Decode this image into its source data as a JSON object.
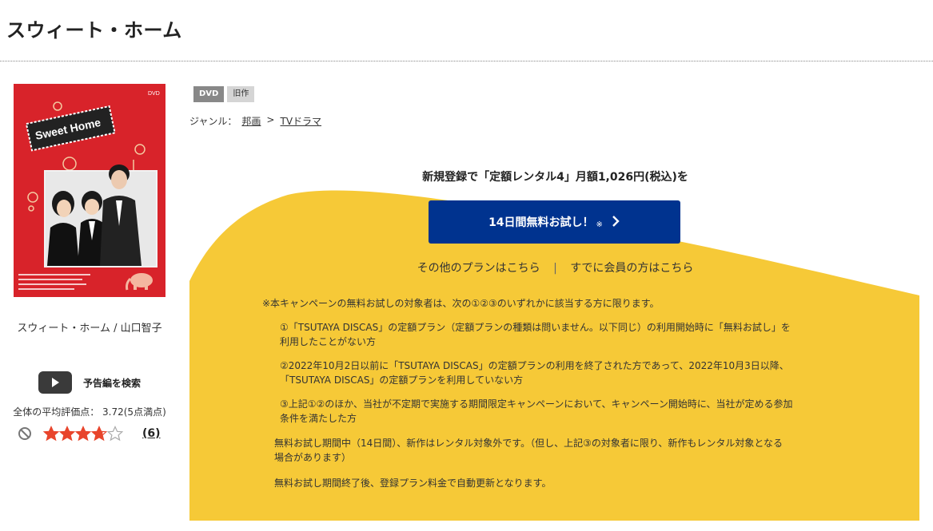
{
  "title": "スウィート・ホーム",
  "poster": {
    "logo_text": "Sweet Home",
    "dvd_mark": "DVD"
  },
  "cast_label": "スウィート・ホーム / 山口智子",
  "trailer": {
    "label": "予告編を検索",
    "icon": "play-icon"
  },
  "rating": {
    "text": "全体の平均評価点： 3.72(5点満点)",
    "value": 3.72,
    "max": 5,
    "review_count": "(6)",
    "star_color": "#e8452c"
  },
  "badges": {
    "dvd": "DVD",
    "old": "旧作"
  },
  "genre": {
    "label": "ジャンル：",
    "path": [
      "邦画",
      "TVドラマ"
    ],
    "separator": ">"
  },
  "promo": {
    "heading": "新規登録で「定額レンタル4」月額1,026円(税込)を",
    "button_label": "14日間無料お試し！",
    "button_note": "※",
    "other_plans": "その他のプランはこちら",
    "divider": "|",
    "members": "すでに会員の方はこちら",
    "bg_color": "#f6c937",
    "button_color": "#00338f"
  },
  "notes": {
    "heading": "※本キャンペーンの無料お試しの対象者は、次の①②③のいずれかに該当する方に限ります。",
    "items": [
      [
        "①「TSUTAYA DISCAS」の定額プラン（定額プランの種類は問いません。以下同じ）の利用開始時に「無料お試し」を",
        "利用したことがない方"
      ],
      [
        "②2022年10月2日以前に「TSUTAYA DISCAS」の定額プランの利用を終了された方であって、2022年10月3日以降、",
        "「TSUTAYA DISCAS」の定額プランを利用していない方"
      ],
      [
        "③上記①②のほか、当社が不定期で実施する期間限定キャンペーンにおいて、キャンペーン開始時に、当社が定める参加",
        "条件を満たした方"
      ]
    ],
    "trial_period": [
      "無料お試し期間中（14日間）、新作はレンタル対象外です。（但し、上記③の対象者に限り、新作もレンタル対象となる",
      "場合があります）"
    ],
    "auto_renew": "無料お試し期間終了後、登録プラン料金で自動更新となります。"
  }
}
